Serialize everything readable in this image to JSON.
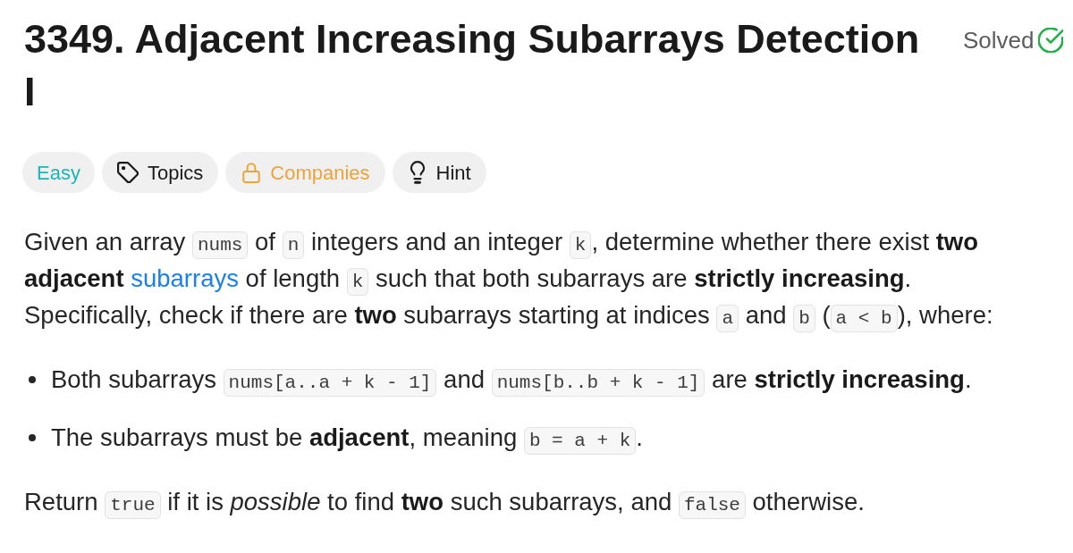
{
  "problem": {
    "title": "3349. Adjacent Increasing Subarrays Detection I",
    "status": "Solved"
  },
  "tags": [
    {
      "kind": "difficulty",
      "label": "Easy"
    },
    {
      "kind": "topics",
      "label": "Topics"
    },
    {
      "kind": "companies",
      "label": "Companies"
    },
    {
      "kind": "hint",
      "label": "Hint"
    }
  ],
  "description": [
    {
      "kind": "paragraph",
      "segments": [
        {
          "kind": "text",
          "text": "Given an array "
        },
        {
          "kind": "code",
          "text": "nums"
        },
        {
          "kind": "text",
          "text": " of "
        },
        {
          "kind": "code",
          "text": "n"
        },
        {
          "kind": "text",
          "text": " integers and an integer "
        },
        {
          "kind": "code",
          "text": "k"
        },
        {
          "kind": "text",
          "text": ", determine whether there exist **two adjacent** "
        },
        {
          "kind": "link",
          "text": "subarrays"
        },
        {
          "kind": "text",
          "text": " of length "
        },
        {
          "kind": "code",
          "text": "k"
        },
        {
          "kind": "text",
          "text": " such that both subarrays are **strictly increasing**. Specifically, check if there are **two** subarrays starting at indices "
        },
        {
          "kind": "code",
          "text": "a"
        },
        {
          "kind": "text",
          "text": " and "
        },
        {
          "kind": "code",
          "text": "b"
        },
        {
          "kind": "text",
          "text": " ("
        },
        {
          "kind": "code",
          "text": "a < b"
        },
        {
          "kind": "text",
          "text": "), where:"
        }
      ]
    },
    {
      "kind": "bullets",
      "items": [
        {
          "segments": [
            {
              "kind": "text",
              "text": "Both subarrays "
            },
            {
              "kind": "code",
              "text": "nums[a..a + k - 1]"
            },
            {
              "kind": "text",
              "text": " and "
            },
            {
              "kind": "code",
              "text": "nums[b..b + k - 1]"
            },
            {
              "kind": "text",
              "text": " are **strictly increasing**."
            }
          ]
        },
        {
          "segments": [
            {
              "kind": "text",
              "text": "The subarrays must be **adjacent**, meaning "
            },
            {
              "kind": "code",
              "text": "b = a + k"
            },
            {
              "kind": "text",
              "text": "."
            }
          ]
        }
      ]
    },
    {
      "kind": "paragraph",
      "segments": [
        {
          "kind": "text",
          "text": "Return "
        },
        {
          "kind": "code",
          "text": "true"
        },
        {
          "kind": "text",
          "text": " if it is *possible* to find **two** such subarrays, and "
        },
        {
          "kind": "code",
          "text": "false"
        },
        {
          "kind": "text",
          "text": " otherwise."
        }
      ]
    }
  ]
}
